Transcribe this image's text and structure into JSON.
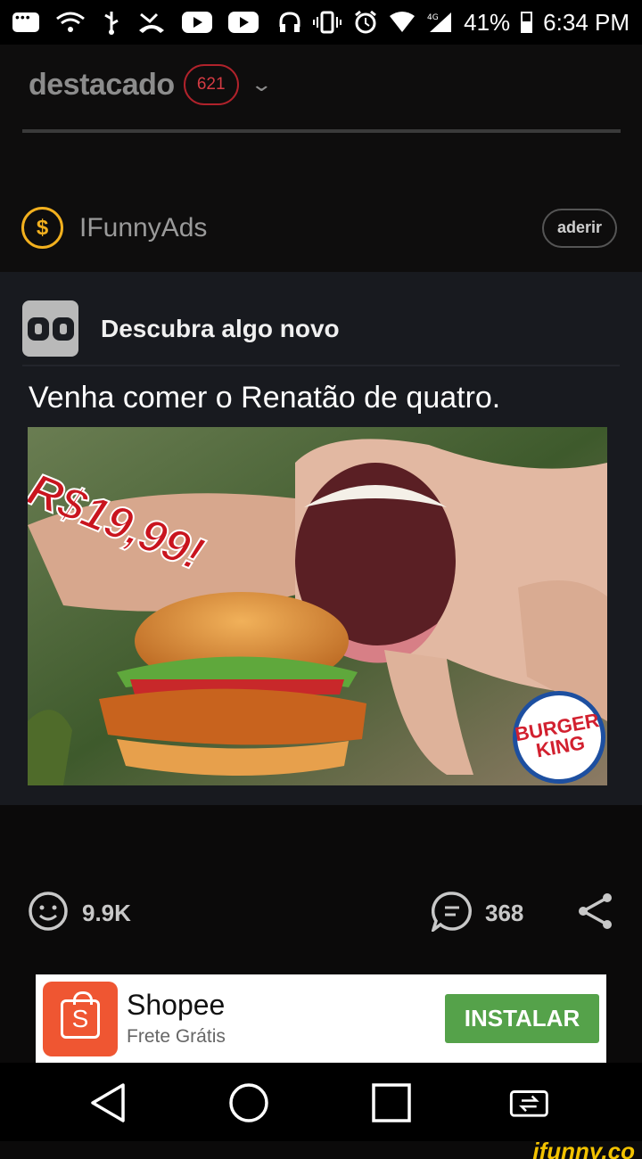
{
  "status_bar": {
    "battery": "41%",
    "time": "6:34 PM",
    "network": "4G"
  },
  "header": {
    "title": "destacado",
    "count": "621"
  },
  "ads_row": {
    "name": "IFunnyAds",
    "join_label": "aderir"
  },
  "post": {
    "source": "Descubra algo novo",
    "caption": "Venha comer o Renatão de quatro.",
    "image": {
      "price": "R$19,99!",
      "brand_logo": "BURGER KING"
    }
  },
  "actions": {
    "smiles": "9.9K",
    "comments": "368"
  },
  "ad": {
    "title": "Shopee",
    "subtitle": "Frete Grátis",
    "cta": "INSTALAR",
    "logo_letter": "S"
  },
  "watermark": "ifunny.co",
  "colors": {
    "badge": "#b0222b",
    "coin": "#f2b01e",
    "install": "#55a24a",
    "shopee": "#ef5632"
  }
}
